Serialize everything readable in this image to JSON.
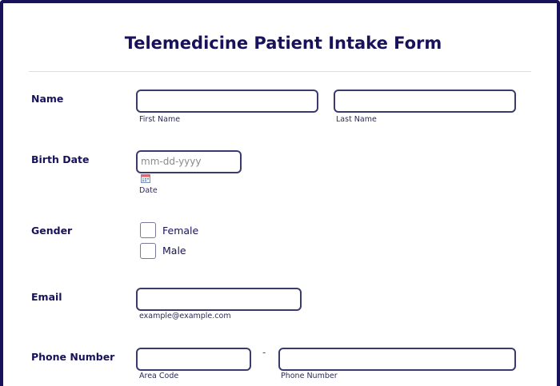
{
  "form": {
    "title": "Telemedicine Patient Intake Form"
  },
  "name": {
    "label": "Name",
    "first_sub": "First Name",
    "last_sub": "Last Name"
  },
  "birth_date": {
    "label": "Birth Date",
    "placeholder": "mm-dd-yyyy",
    "sub": "Date",
    "icon": "calendar-icon"
  },
  "gender": {
    "label": "Gender",
    "options": [
      "Female",
      "Male"
    ]
  },
  "email": {
    "label": "Email",
    "sub": "example@example.com"
  },
  "phone": {
    "label": "Phone Number",
    "separator": "-",
    "area_sub": "Area Code",
    "number_sub": "Phone Number"
  },
  "colors": {
    "primary": "#17125a",
    "input_border": "#3a3a6e",
    "divider": "#dedede"
  }
}
